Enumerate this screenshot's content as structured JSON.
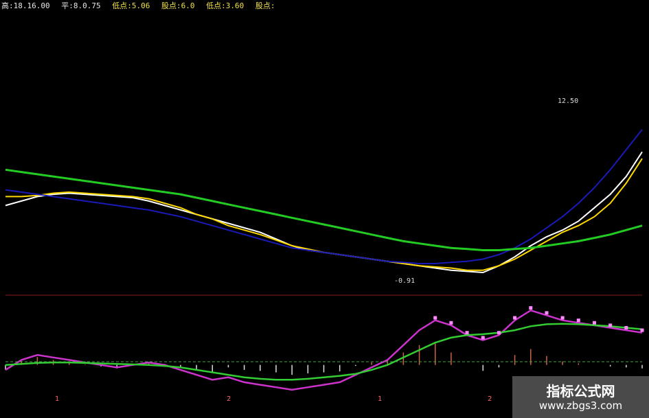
{
  "header": [
    "高:18.16.00",
    "平:8.0.75",
    "低点:5.06",
    "股点:6.0",
    "低点:3.60",
    "股点:"
  ],
  "colors": {
    "background": "#000000",
    "up": "#ffff00",
    "down": "#00ffff",
    "ma_white": "#ffffff",
    "ma_yellow": "#ffd800",
    "ma_blue": "#1a1ab8",
    "ma_green": "#22cc22",
    "divider": "#8b1a1a",
    "macd_pink": "#cc33cc",
    "macd_green": "#33cc33",
    "signal_dots": "#ff88ff"
  },
  "chart_data": [
    {
      "type": "candlestick",
      "annotations": [
        {
          "text": "12.50",
          "marker": "high"
        },
        {
          "text": "-0.91",
          "marker": "low"
        }
      ],
      "series": [
        {
          "type": "line",
          "color": "ma_white",
          "values": [
            7.9,
            8.1,
            8.3,
            8.4,
            8.45,
            8.4,
            8.35,
            8.3,
            8.25,
            8.1,
            7.9,
            7.7,
            7.5,
            7.3,
            7.1,
            6.9,
            6.7,
            6.4,
            6.1,
            5.9,
            5.8,
            5.7,
            5.6,
            5.5,
            5.4,
            5.3,
            5.2,
            5.1,
            5.0,
            4.95,
            4.9,
            5.2,
            5.6,
            6.1,
            6.5,
            6.8,
            7.2,
            7.8,
            8.4,
            9.2,
            10.3
          ]
        },
        {
          "type": "line",
          "color": "ma_yellow",
          "values": [
            8.3,
            8.3,
            8.35,
            8.45,
            8.5,
            8.45,
            8.4,
            8.35,
            8.3,
            8.2,
            8.0,
            7.8,
            7.5,
            7.3,
            7.0,
            6.8,
            6.6,
            6.35,
            6.1,
            5.95,
            5.8,
            5.7,
            5.6,
            5.5,
            5.4,
            5.3,
            5.2,
            5.15,
            5.1,
            5.0,
            5.0,
            5.2,
            5.5,
            5.9,
            6.3,
            6.7,
            7.0,
            7.4,
            8.0,
            8.9,
            10.0
          ]
        },
        {
          "type": "line",
          "color": "ma_blue",
          "values": [
            8.6,
            8.5,
            8.4,
            8.3,
            8.2,
            8.1,
            8.0,
            7.9,
            7.8,
            7.7,
            7.55,
            7.4,
            7.2,
            7.0,
            6.8,
            6.6,
            6.4,
            6.2,
            6.0,
            5.9,
            5.8,
            5.7,
            5.6,
            5.5,
            5.4,
            5.35,
            5.3,
            5.3,
            5.35,
            5.4,
            5.5,
            5.7,
            6.0,
            6.4,
            6.9,
            7.4,
            8.0,
            8.7,
            9.5,
            10.4,
            11.3
          ]
        },
        {
          "type": "line",
          "color": "ma_green",
          "values": [
            9.5,
            9.4,
            9.3,
            9.2,
            9.1,
            9.0,
            8.9,
            8.8,
            8.7,
            8.6,
            8.5,
            8.4,
            8.25,
            8.1,
            7.95,
            7.8,
            7.65,
            7.5,
            7.35,
            7.2,
            7.05,
            6.9,
            6.75,
            6.6,
            6.45,
            6.3,
            6.2,
            6.1,
            6.0,
            5.95,
            5.9,
            5.9,
            5.95,
            6.0,
            6.1,
            6.2,
            6.3,
            6.45,
            6.6,
            6.8,
            7.0
          ]
        }
      ]
    },
    {
      "type": "macd",
      "series": [
        {
          "type": "line",
          "color": "macd_pink",
          "values": [
            -0.1,
            0.1,
            0.2,
            0.15,
            0.1,
            0.05,
            0.0,
            -0.05,
            0.0,
            0.05,
            0.0,
            -0.1,
            -0.2,
            -0.3,
            -0.25,
            -0.35,
            -0.4,
            -0.45,
            -0.5,
            -0.45,
            -0.4,
            -0.35,
            -0.2,
            -0.05,
            0.1,
            0.4,
            0.7,
            0.9,
            0.8,
            0.6,
            0.5,
            0.6,
            0.9,
            1.1,
            1.0,
            0.9,
            0.85,
            0.8,
            0.75,
            0.7,
            0.65
          ]
        },
        {
          "type": "line",
          "color": "macd_green",
          "values": [
            0.0,
            0.02,
            0.04,
            0.05,
            0.05,
            0.04,
            0.03,
            0.02,
            0.01,
            0.0,
            -0.02,
            -0.05,
            -0.1,
            -0.15,
            -0.2,
            -0.25,
            -0.28,
            -0.3,
            -0.3,
            -0.28,
            -0.25,
            -0.22,
            -0.18,
            -0.1,
            0.0,
            0.15,
            0.3,
            0.45,
            0.55,
            0.6,
            0.62,
            0.65,
            0.7,
            0.78,
            0.82,
            0.83,
            0.82,
            0.8,
            0.78,
            0.75,
            0.72
          ]
        }
      ]
    }
  ],
  "bottom_markers": [
    "1",
    "2",
    "1",
    "2"
  ],
  "watermark": {
    "title": "指标公式网",
    "url": "www.zbgs3.com"
  }
}
